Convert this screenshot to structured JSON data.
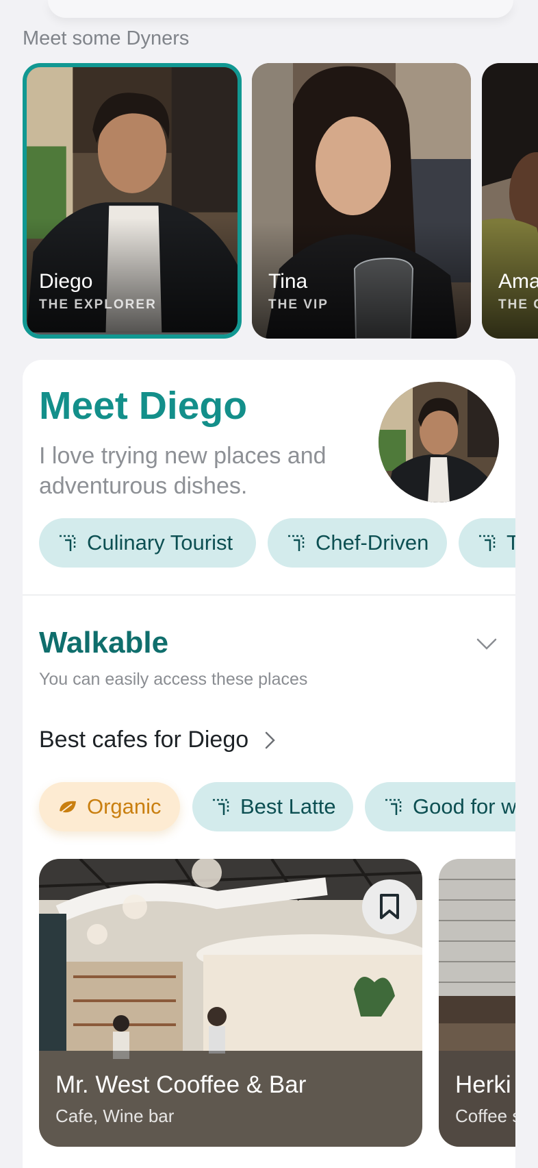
{
  "section": {
    "title": "Meet some Dyners"
  },
  "dyners": [
    {
      "name": "Diego",
      "role": "THE EXPLORER",
      "selected": true
    },
    {
      "name": "Tina",
      "role": "THE VIP",
      "selected": false
    },
    {
      "name": "Ama",
      "role": "THE C",
      "selected": false
    }
  ],
  "profile": {
    "title": "Meet Diego",
    "bio": "I love trying new places and adventurous dishes.",
    "tags": [
      "Culinary Tourist",
      "Chef-Driven",
      "T"
    ]
  },
  "walkable": {
    "title": "Walkable",
    "subtitle": "You can easily access these places",
    "link_label": "Best cafes for Diego",
    "filters": [
      "Organic",
      "Best Latte",
      "Good for w"
    ]
  },
  "places": [
    {
      "name": "Mr. West Cooffee & Bar",
      "type": "Cafe, Wine bar"
    },
    {
      "name": "Herki",
      "type": "Coffee s"
    }
  ],
  "colors": {
    "accent": "#119892",
    "chip_bg": "#d3ebec",
    "organic_bg": "#fdebd2",
    "organic_fg": "#c97f10"
  }
}
